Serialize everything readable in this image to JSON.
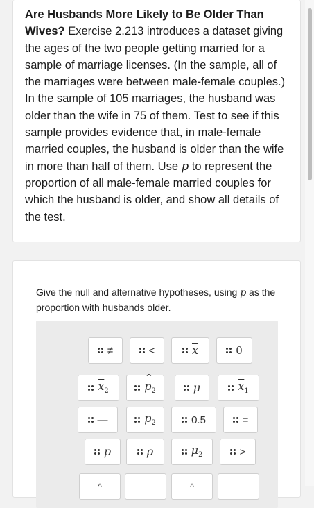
{
  "problem": {
    "title": "Are Husbands More Likely to Be Older Than Wives?",
    "body_1": " Exercise 2.213 introduces a dataset giving the ages of the two people getting married for a sample of marriage licenses. (In the sample, all of the marriages were between male-female couples.) In the sample of 105 marriages, the husband was older than the wife in 75 of them. Test to see if this sample provides evidence that, in male-female married couples, the husband is older than the wife in more than half of them. Use ",
    "var": "p",
    "body_2": " to represent the proportion of all male-female married couples for which the husband is older, and show all details of the test."
  },
  "question": {
    "prompt_1": "Give the null and alternative hypotheses, using ",
    "var": "p",
    "prompt_2": " as the proportion with husbands older."
  },
  "tiles": {
    "neq": "≠",
    "lt": "<",
    "xbar": "x",
    "zero": "0",
    "xbar2": "x",
    "xbar2_sub": "2",
    "phat2": "p",
    "phat2_sub": "2",
    "mu": "μ",
    "xbar1": "x",
    "xbar1_sub": "1",
    "minus": "—",
    "p2": "p",
    "p2_sub": "2",
    "half": "0.5",
    "eq": "=",
    "p": "p",
    "rho": "ρ",
    "mu2": "μ",
    "mu2_sub": "2",
    "gt": ">"
  },
  "partial_row": [
    "^",
    "",
    "^",
    ""
  ]
}
